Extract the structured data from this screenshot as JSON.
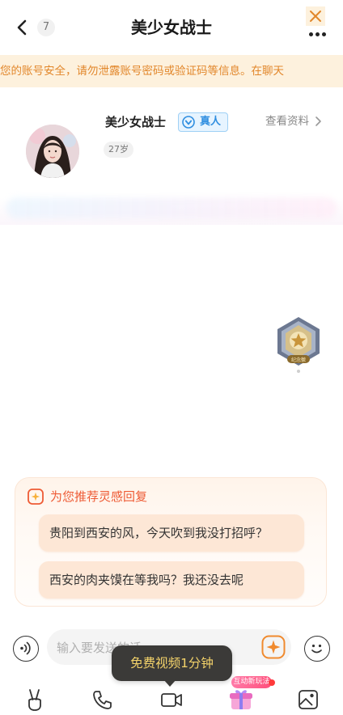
{
  "header": {
    "unread_count": "7",
    "title": "美少女战士"
  },
  "notice": {
    "text": "您的账号安全，请勿泄露账号密码或验证码等信息。在聊天"
  },
  "profile": {
    "name": "美少女战士",
    "verified_label": "真人",
    "age": "27岁",
    "view_profile_label": "查看资料"
  },
  "medal": {
    "label": "纪念徽"
  },
  "suggestions": {
    "title": "为您推荐灵感回复",
    "items": [
      "贵阳到西安的风，今天吹到我没打招呼？",
      "西安的肉夹馍在等我吗？我还没去呢"
    ]
  },
  "composer": {
    "placeholder": "输入要发送的话"
  },
  "tooltip": {
    "text": "免费视频1分钟"
  },
  "toolbar": {
    "gift_tag": "互动新玩法"
  },
  "colors": {
    "notice_bg": "#fdf1dd",
    "notice_text": "#e2872b",
    "accent_orange": "#ee5b35",
    "verified_blue": "#2f8ee0",
    "tooltip_text": "#f4d36a"
  }
}
